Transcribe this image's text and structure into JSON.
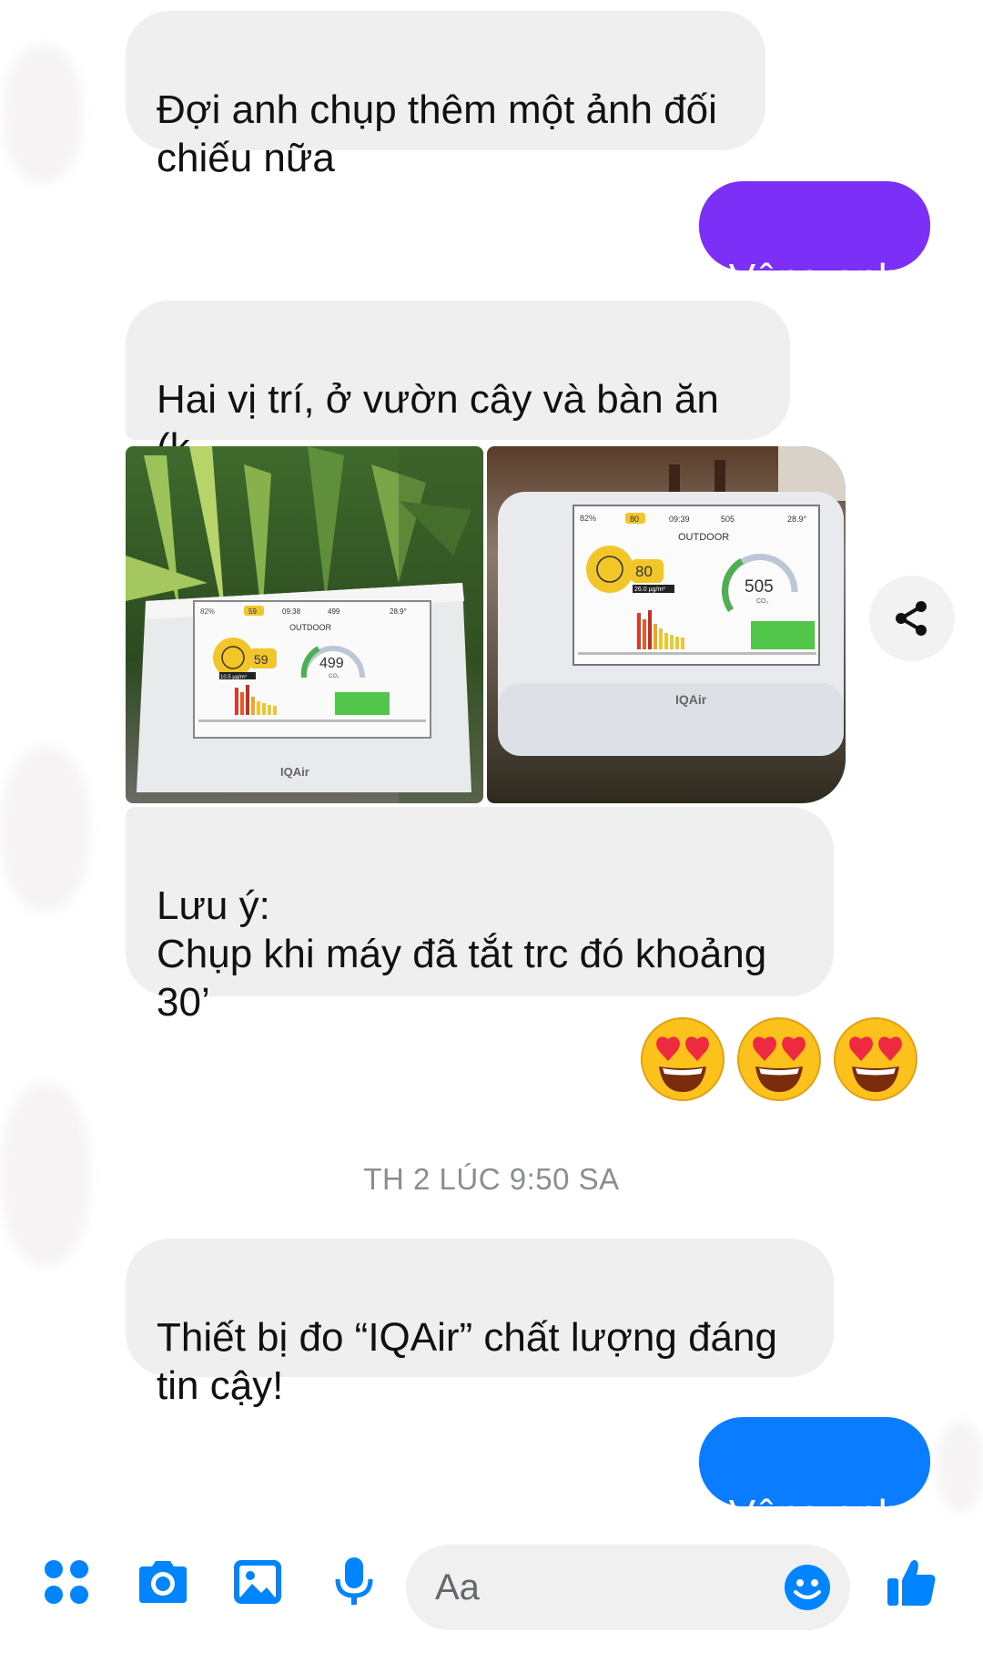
{
  "messages": {
    "m1": "Đợi anh chụp thêm một ảnh đối\nchiếu nữa",
    "m2": "Vâng anh",
    "m3": "Hai vị trí, ở vườn cây và bàn ăn (k\ncó máy)",
    "m4": "Lưu ý:\nChụp khi máy đã tắt trc đó khoảng\n30’",
    "m5": "Thiết bị đo “IQAir” chất lượng đáng\ntin cậy!",
    "m6": "Vâng anh"
  },
  "reaction_emojis": [
    "heart-eyes",
    "heart-eyes",
    "heart-eyes"
  ],
  "timestamp": "TH 2 LÚC 9:50 SA",
  "photos": {
    "photo1": {
      "humidity": "82%",
      "aqi_top": "59",
      "time": "09:38",
      "co2_top": "499",
      "temp": "28.9°",
      "mode": "OUTDOOR",
      "aqi_value": "59",
      "pm_reading": "10.5 µg/m³",
      "co2_value": "499",
      "co2_unit": "CO₂",
      "brand": "IQAir"
    },
    "photo2": {
      "humidity": "82%",
      "aqi_top": "80",
      "time": "09:39",
      "co2_top": "505",
      "temp": "28.9°",
      "mode": "OUTDOOR",
      "aqi_value": "80",
      "pm_reading": "26.0 µg/m³",
      "co2_value": "505",
      "co2_unit": "CO₂",
      "brand": "IQAir"
    }
  },
  "composer": {
    "placeholder": "Aa"
  },
  "colors": {
    "outgoing_purple": "#7b2ff7",
    "outgoing_blue": "#0a7cff",
    "incoming_gray": "#efefef",
    "icon_blue": "#0084ff"
  }
}
